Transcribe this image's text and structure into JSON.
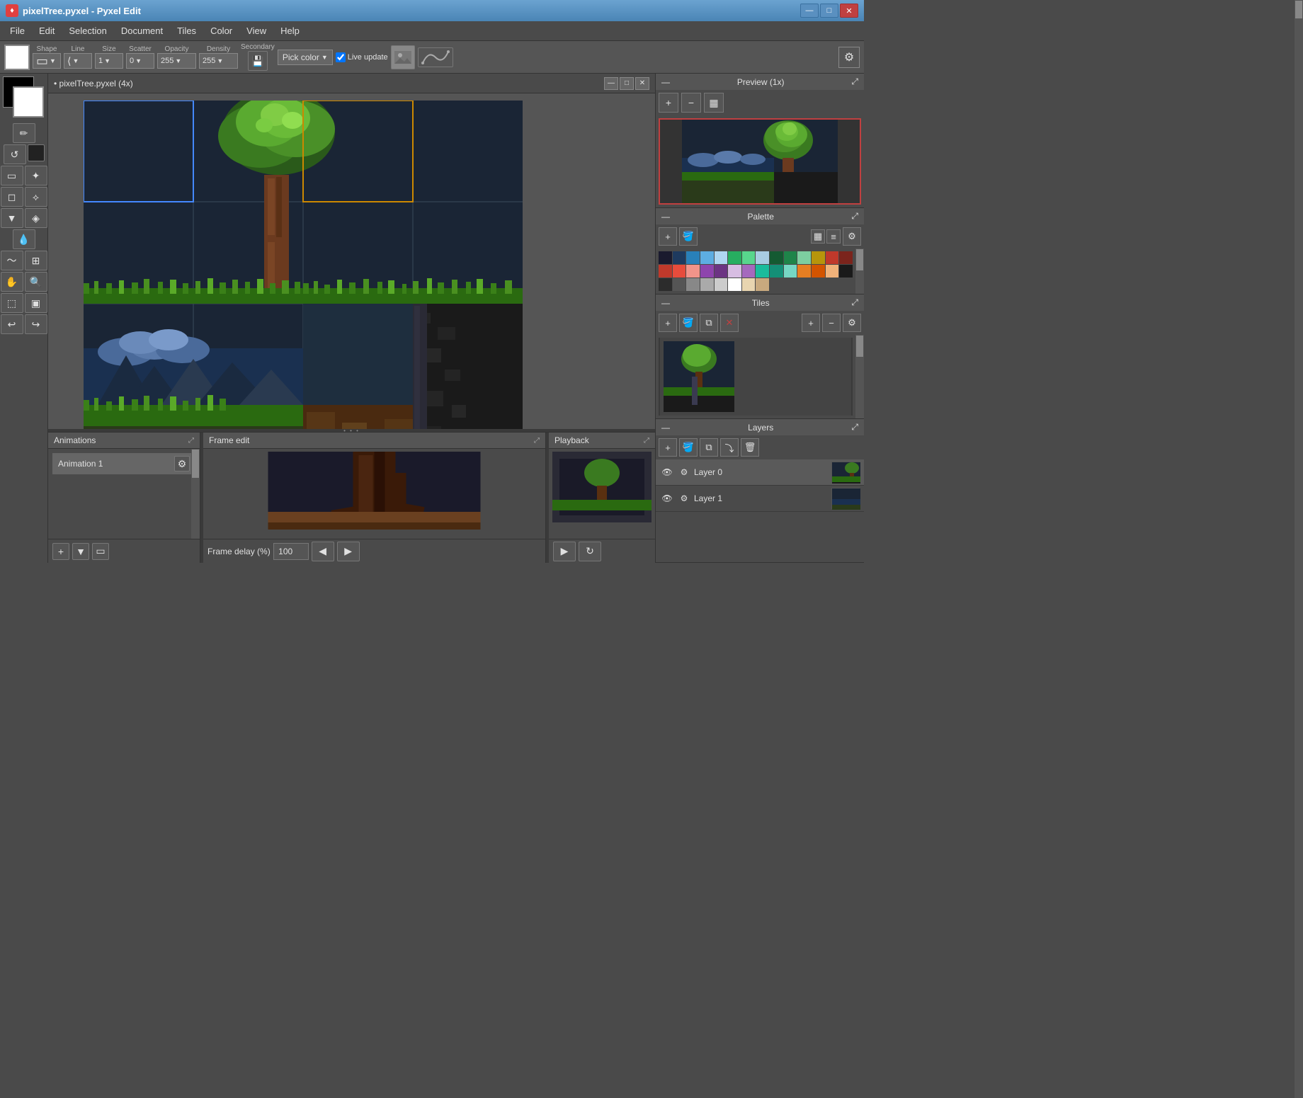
{
  "titlebar": {
    "title": "pixelTree.pyxel - Pyxel Edit",
    "icon": "♦",
    "controls": [
      "—",
      "□",
      "✕"
    ]
  },
  "menubar": {
    "items": [
      "File",
      "Edit",
      "Selection",
      "Document",
      "Tiles",
      "Color",
      "View",
      "Help"
    ]
  },
  "toolbar": {
    "shape_label": "Shape",
    "line_label": "Line",
    "size_label": "Size",
    "size_value": "1",
    "scatter_label": "Scatter",
    "scatter_value": "0",
    "opacity_label": "Opacity",
    "opacity_value": "255",
    "density_label": "Density",
    "density_value": "255",
    "secondary_label": "Secondary",
    "pick_color_label": "Pick color",
    "live_update_label": "Live update",
    "gear_icon": "⚙"
  },
  "canvas": {
    "title": "• pixelTree.pyxel  (4x)",
    "controls": [
      "—",
      "□",
      "✕"
    ]
  },
  "left_tools": {
    "tools": [
      {
        "name": "pencil",
        "icon": "✏"
      },
      {
        "name": "rotate",
        "icon": "↺"
      },
      {
        "name": "select-rect",
        "icon": "▭"
      },
      {
        "name": "magic-wand",
        "icon": "✦"
      },
      {
        "name": "eraser",
        "icon": "◻"
      },
      {
        "name": "smudge",
        "icon": "⟡"
      },
      {
        "name": "fill",
        "icon": "▼"
      },
      {
        "name": "eyedropper",
        "icon": "💧"
      },
      {
        "name": "wave",
        "icon": "〜"
      },
      {
        "name": "select-all",
        "icon": "⊞"
      },
      {
        "name": "hand",
        "icon": "✋"
      },
      {
        "name": "zoom",
        "icon": "🔍"
      },
      {
        "name": "marquee",
        "icon": "⬚"
      },
      {
        "name": "select-frame",
        "icon": "▣"
      },
      {
        "name": "undo-curve",
        "icon": "↩"
      },
      {
        "name": "redo-curve",
        "icon": "↪"
      }
    ]
  },
  "preview": {
    "title": "Preview (1x)",
    "zoom_in_icon": "+",
    "zoom_out_icon": "−",
    "checker_icon": "▦"
  },
  "palette": {
    "title": "Palette",
    "add_icon": "+",
    "bucket_icon": "🪣",
    "gear_icon": "⚙",
    "colors": [
      "#1a1a2e",
      "#1e3a5f",
      "#2980b9",
      "#5dade2",
      "#aed6f1",
      "#27ae60",
      "#58d68d",
      "#a9cce3",
      "#145a32",
      "#1e8449",
      "#7dcea0",
      "#b7950b",
      "#c0392b",
      "#7b241c",
      "#c0392b",
      "#e74c3c",
      "#f1948a",
      "#8e44ad",
      "#6c3483",
      "#d7bde2",
      "#a569bd",
      "#1abc9c",
      "#148f77",
      "#76d7c4",
      "#e67e22",
      "#d35400",
      "#f0b27a",
      "#1a1a1a",
      "#2c2c2c",
      "#555555",
      "#888888",
      "#aaaaaa",
      "#cccccc",
      "#ffffff",
      "#e8d5b0",
      "#c8a97e"
    ]
  },
  "tiles": {
    "title": "Tiles",
    "add_icon": "+",
    "bucket_icon": "🪣",
    "copy_icon": "⧉",
    "delete_icon": "✕",
    "zoom_in_icon": "+",
    "zoom_out_icon": "−",
    "gear_icon": "⚙"
  },
  "layers": {
    "title": "Layers",
    "add_icon": "+",
    "bucket_icon": "🪣",
    "copy_icon": "⧉",
    "merge_icon": "⤵",
    "delete_icon": "🗑",
    "items": [
      {
        "name": "Layer 0",
        "visible": true
      },
      {
        "name": "Layer 1",
        "visible": true
      }
    ]
  },
  "animations": {
    "title": "Animations",
    "items": [
      "Animation 1"
    ],
    "add_icon": "+",
    "fill_icon": "▼",
    "select_icon": "▭"
  },
  "frame_edit": {
    "title": "Frame edit",
    "delay_label": "Frame delay (%)",
    "delay_value": "100",
    "prev_icon": "◀",
    "next_icon": "▶",
    "play_icon": "▶",
    "loop_icon": "↻"
  },
  "playback": {
    "title": "Playback"
  }
}
